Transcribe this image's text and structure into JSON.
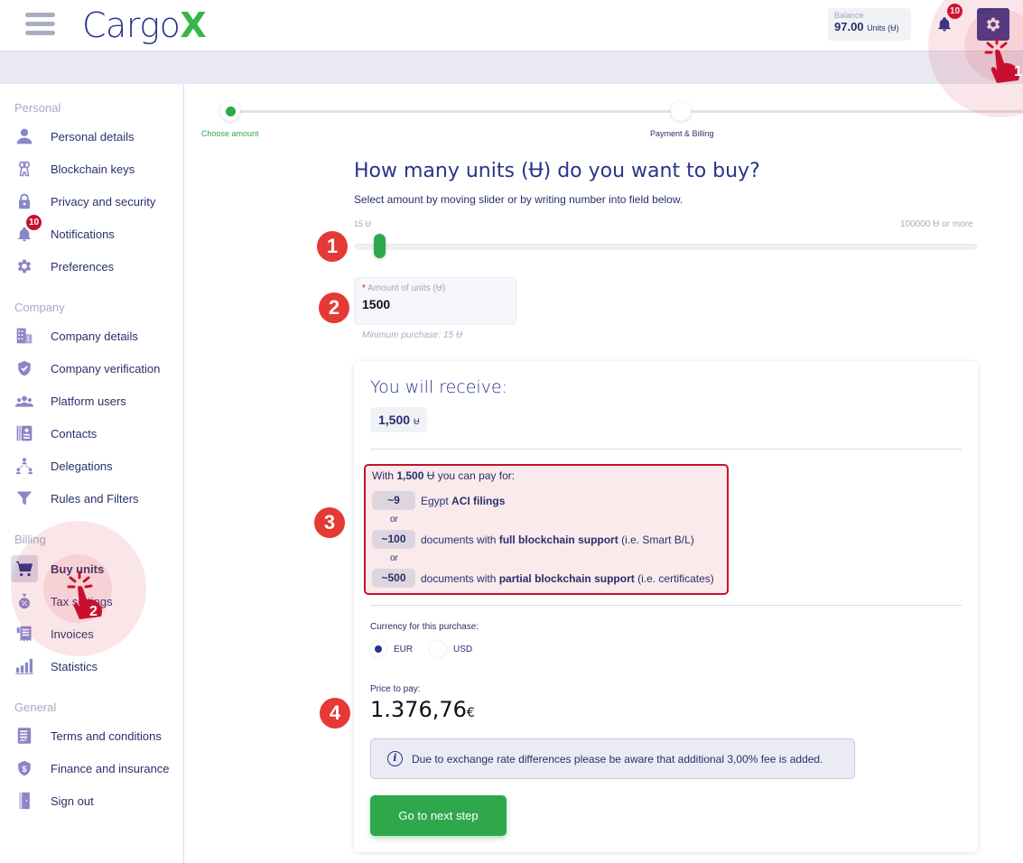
{
  "header": {
    "brand": "Cargo",
    "brand_accent": "X",
    "balance_label": "Balance",
    "balance_value": "97.00",
    "balance_unit": "Units (Ʉ)",
    "notifications_count": "10"
  },
  "sidebar": {
    "sections": [
      {
        "title": "Personal",
        "items": [
          {
            "label": "Personal details",
            "icon": "user-icon"
          },
          {
            "label": "Blockchain keys",
            "icon": "keys-icon"
          },
          {
            "label": "Privacy and security",
            "icon": "lock-icon"
          },
          {
            "label": "Notifications",
            "icon": "bell-icon",
            "badge": "10"
          },
          {
            "label": "Preferences",
            "icon": "gear-icon"
          }
        ]
      },
      {
        "title": "Company",
        "items": [
          {
            "label": "Company details",
            "icon": "building-icon"
          },
          {
            "label": "Company verification",
            "icon": "shield-check-icon"
          },
          {
            "label": "Platform users",
            "icon": "users-icon"
          },
          {
            "label": "Contacts",
            "icon": "contacts-icon"
          },
          {
            "label": "Delegations",
            "icon": "delegations-icon"
          },
          {
            "label": "Rules and Filters",
            "icon": "filter-icon"
          }
        ]
      },
      {
        "title": "Billing",
        "items": [
          {
            "label": "Buy units",
            "icon": "cart-icon",
            "active": true
          },
          {
            "label": "Tax settings",
            "icon": "money-bag-icon"
          },
          {
            "label": "Invoices",
            "icon": "receipt-icon"
          },
          {
            "label": "Statistics",
            "icon": "bar-chart-icon"
          }
        ]
      },
      {
        "title": "General",
        "items": [
          {
            "label": "Terms and conditions",
            "icon": "document-icon"
          },
          {
            "label": "Finance and insurance",
            "icon": "shield-dollar-icon"
          },
          {
            "label": "Sign out",
            "icon": "door-icon"
          }
        ]
      }
    ]
  },
  "stepper": {
    "steps": [
      {
        "label": "Choose amount",
        "active": true
      },
      {
        "label": "Payment & Billing",
        "active": false
      }
    ]
  },
  "main": {
    "title": "How many units (Ʉ) do you want to buy?",
    "subtitle": "Select amount by moving slider or by writing number into field below.",
    "slider_min_label": "15 Ʉ",
    "slider_max_label": "100000 Ʉ or more",
    "slider_value": 1500,
    "amount_label": "Amount of units (Ʉ)",
    "amount_required": "*",
    "amount_value": "1500",
    "min_note": "Minimum purchase: 15 Ʉ",
    "receive_title": "You will receive:",
    "receive_value": "1,500",
    "receive_unit": "Ʉ",
    "pay_head_prefix": "With",
    "pay_head_amount": "1,500",
    "pay_head_suffix": "Ʉ you can pay for:",
    "pay_or": "or",
    "pay_options": [
      {
        "qty": "~9",
        "pre": "Egypt",
        "bold": "ACI filings",
        "post": ""
      },
      {
        "qty": "~100",
        "pre": "documents with",
        "bold": "full blockchain support",
        "post": "(i.e. Smart B/L)"
      },
      {
        "qty": "~500",
        "pre": "documents with",
        "bold": "partial blockchain support",
        "post": "(i.e. certificates)"
      }
    ],
    "currency_label": "Currency for this purchase:",
    "currencies": [
      {
        "label": "EUR",
        "selected": true
      },
      {
        "label": "USD",
        "selected": false
      }
    ],
    "price_label": "Price to pay:",
    "price_value": "1.376,76",
    "price_symbol": "€",
    "info_text": "Due to exchange rate differences please be aware that additional 3,00% fee is added.",
    "next_button": "Go to next step"
  },
  "annotations": {
    "markers": [
      "1",
      "2",
      "3",
      "4"
    ],
    "click_labels": [
      "1",
      "2"
    ],
    "accent_color": "#e53935"
  }
}
